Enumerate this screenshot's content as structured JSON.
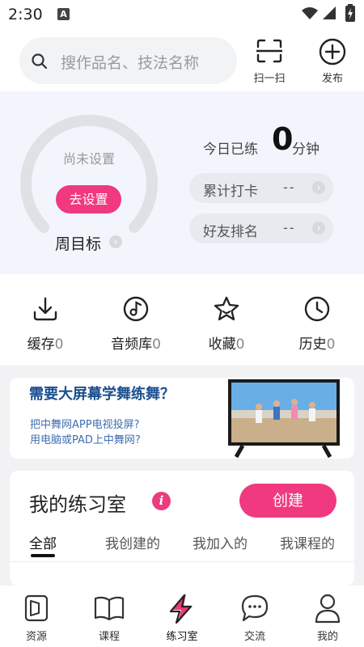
{
  "status": {
    "time": "2:30",
    "a_icon": "A"
  },
  "search": {
    "placeholder": "搜作品名、技法名称"
  },
  "top_actions": {
    "scan_label": "扫一扫",
    "publish_label": "发布"
  },
  "goal": {
    "status": "尚未设置",
    "set_button": "去设置",
    "week_goal": "周目标",
    "today_label": "今日已练",
    "today_value": "0",
    "today_unit": "分钟",
    "checkin_label": "累计打卡",
    "checkin_value": "--",
    "rank_label": "好友排名",
    "rank_value": "--"
  },
  "quick": [
    {
      "label": "缓存",
      "count": "0",
      "icon": "download-icon"
    },
    {
      "label": "音频库",
      "count": "0",
      "icon": "music-disc-icon"
    },
    {
      "label": "收藏",
      "count": "0",
      "icon": "star-icon"
    },
    {
      "label": "历史",
      "count": "0",
      "icon": "clock-icon"
    }
  ],
  "banner": {
    "title": "需要大屏幕学舞练舞？",
    "line1": "把中舞网APP电视投屏?",
    "line2": "用电脑或PAD上中舞网?"
  },
  "practice": {
    "title": "我的练习室",
    "create_button": "创建",
    "tabs": [
      "全部",
      "我创建的",
      "我加入的",
      "我课程的"
    ],
    "active_tab": "全部"
  },
  "bottom_nav": [
    {
      "label": "资源",
      "icon": "resource-icon"
    },
    {
      "label": "课程",
      "icon": "book-icon"
    },
    {
      "label": "练习室",
      "icon": "lightning-icon"
    },
    {
      "label": "交流",
      "icon": "chat-icon"
    },
    {
      "label": "我的",
      "icon": "person-icon"
    }
  ],
  "active_nav": "练习室",
  "colors": {
    "accent": "#f0397e",
    "panel_bg": "#f2f6fc",
    "banner_text": "#1b4f8f"
  }
}
